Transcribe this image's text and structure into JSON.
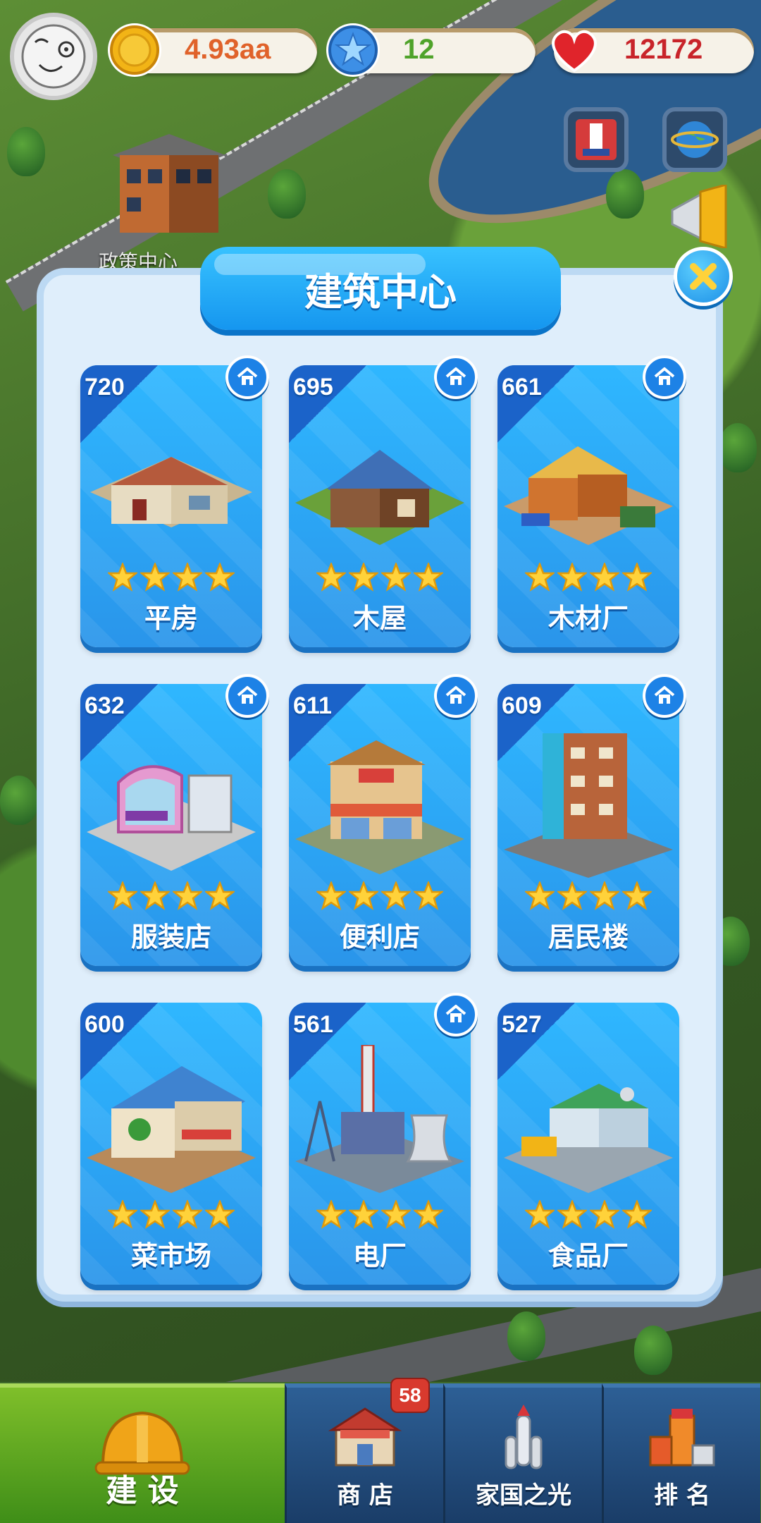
{
  "map": {
    "policy_label": "政策中心"
  },
  "hud": {
    "coins": "4.93aa",
    "stars": "12",
    "hearts": "12172",
    "colors": {
      "coins": "#e0622a",
      "stars": "#4fa32a",
      "hearts": "#c8242a"
    }
  },
  "dialog": {
    "title": "建筑中心",
    "cards": [
      {
        "level": "720",
        "name": "平房",
        "stars": 4,
        "home": true
      },
      {
        "level": "695",
        "name": "木屋",
        "stars": 4,
        "home": true
      },
      {
        "level": "661",
        "name": "木材厂",
        "stars": 4,
        "home": true
      },
      {
        "level": "632",
        "name": "服装店",
        "stars": 4,
        "home": true
      },
      {
        "level": "611",
        "name": "便利店",
        "stars": 4,
        "home": true
      },
      {
        "level": "609",
        "name": "居民楼",
        "stars": 4,
        "home": true
      },
      {
        "level": "600",
        "name": "菜市场",
        "stars": 4,
        "home": false
      },
      {
        "level": "561",
        "name": "电厂",
        "stars": 4,
        "home": true
      },
      {
        "level": "527",
        "name": "食品厂",
        "stars": 4,
        "home": false
      }
    ],
    "building_signs": {
      "wood_factory": "木材厂",
      "clothing_shop": "服装店",
      "convenience": "便利店",
      "market": "菜市场"
    }
  },
  "nav": {
    "build": "建 设",
    "shop": "商 店",
    "shop_badge": "58",
    "homeland": "家国之光",
    "rank": "排 名"
  }
}
